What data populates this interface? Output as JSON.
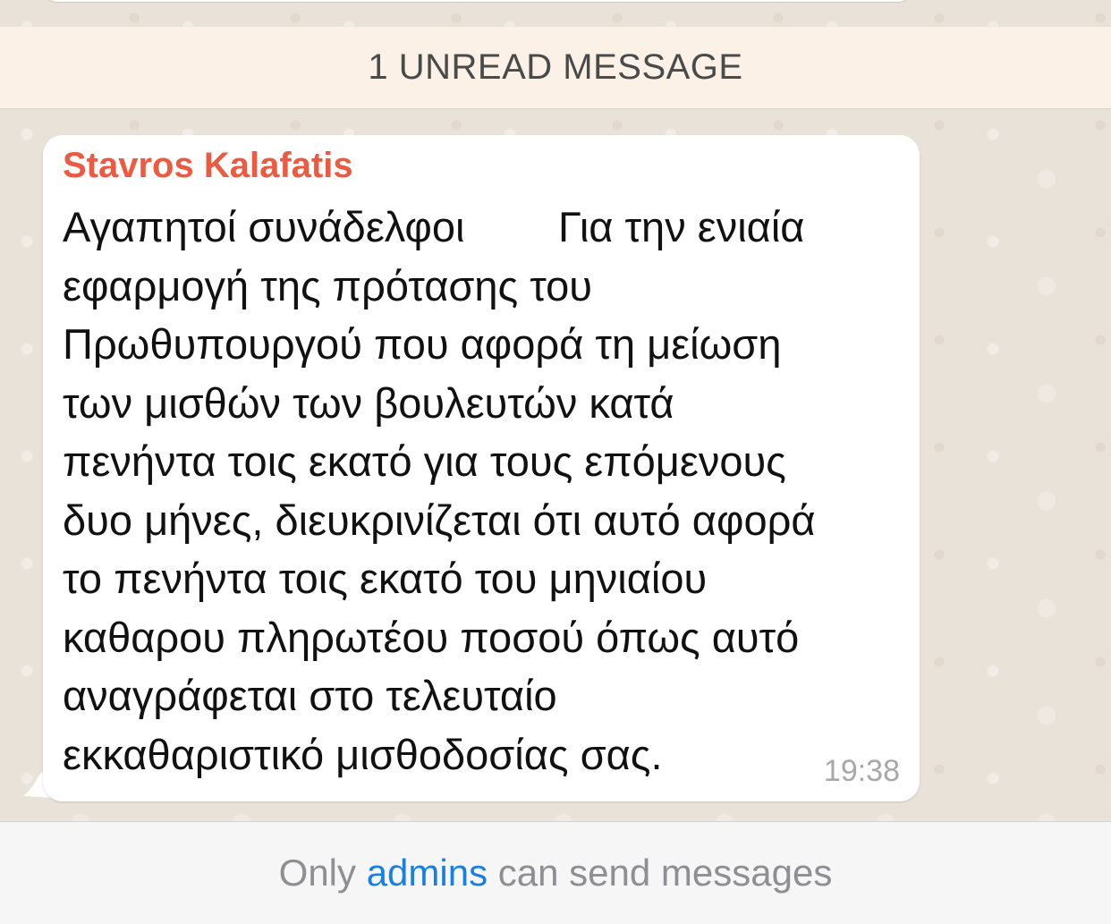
{
  "unread_banner": {
    "text": "1 UNREAD MESSAGE"
  },
  "message": {
    "sender": "Stavros Kalafatis",
    "sender_color": "#ec5b41",
    "lines": [
      "Αγαπητοί συνάδελφοι        Για την ενιαία",
      "εφαρμογή της πρότασης του",
      "Πρωθυπουργού που αφορά τη μείωση",
      "των μισθών των βουλευτών κατά",
      "πενήντα τοις εκατό για τους επόμενους",
      "δυο μήνες, διευκρινίζεται ότι αυτό αφορά",
      "το πενήντα τοις εκατό του μηνιαίου",
      "καθαρου πληρωτέου ποσού όπως αυτό",
      "αναγράφεται στο τελευταίο",
      "εκκαθαριστικό μισθοδοσίας σας."
    ],
    "time": "19:38"
  },
  "footer": {
    "prefix": "Only",
    "link": "admins",
    "suffix": "can send messages",
    "link_color": "#1a80e0"
  }
}
